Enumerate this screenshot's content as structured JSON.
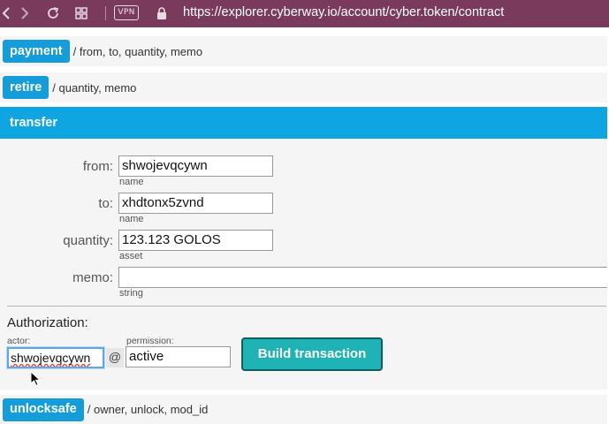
{
  "browser": {
    "url": "https://explorer.cyberway.io/account/cyber.token/contract",
    "vpn_label": "VPN"
  },
  "methods": {
    "payment": {
      "label": "payment",
      "args": "/ from, to, quantity, memo"
    },
    "retire": {
      "label": "retire",
      "args": "/ quantity, memo"
    },
    "unlocksafe": {
      "label": "unlocksafe",
      "args": "/ owner, unlock, mod_id"
    }
  },
  "transfer": {
    "title": "transfer",
    "fields": [
      {
        "label": "from:",
        "value": "shwojevqcywn",
        "type": "name"
      },
      {
        "label": "to:",
        "value": "xhdtonx5zvnd",
        "type": "name"
      },
      {
        "label": "quantity:",
        "value": "123.123 GOLOS",
        "type": "asset"
      },
      {
        "label": "memo:",
        "value": "",
        "type": "string"
      }
    ],
    "authorization": {
      "title": "Authorization:",
      "actor_label": "actor:",
      "actor_value": "shwojevqcywn",
      "at_symbol": "@",
      "permission_label": "permission:",
      "permission_value": "active"
    },
    "build_button": "Build transaction"
  },
  "colors": {
    "browser_bar": "#7a3a5c",
    "method_tag": "#159dd9",
    "panel_head": "#0ea5e2",
    "build_button": "#1fb3b5"
  },
  "icons": [
    "back-icon",
    "forward-icon",
    "reload-icon",
    "grid-icon",
    "lock-icon",
    "cursor-icon"
  ]
}
